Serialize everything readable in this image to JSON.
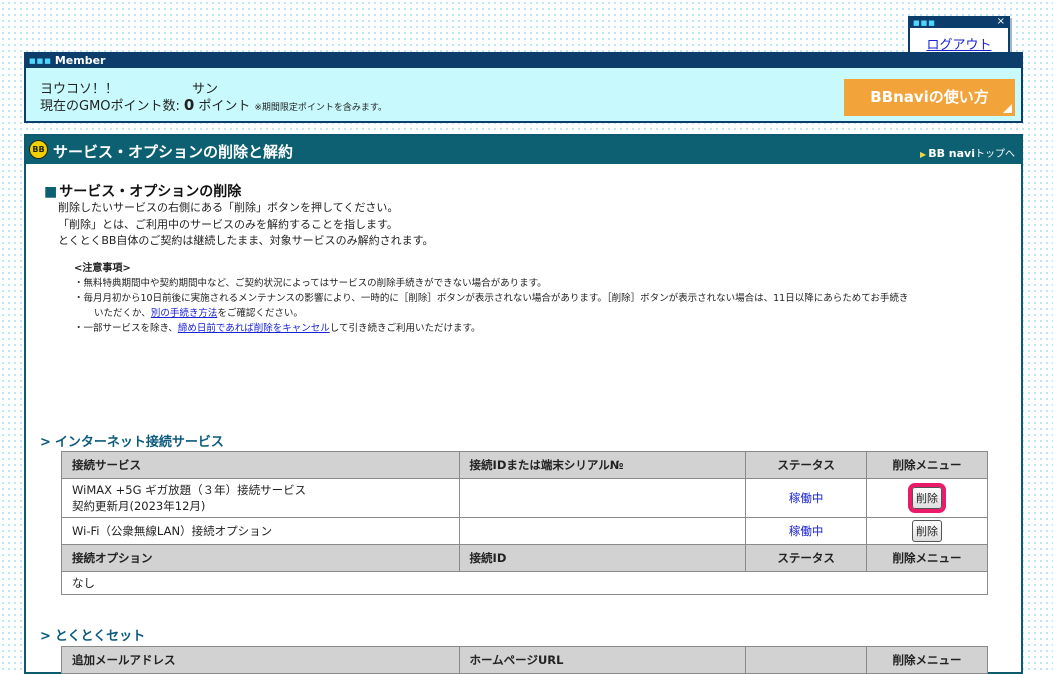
{
  "logout": {
    "label": "ログアウト"
  },
  "member": {
    "header": "Member",
    "greeting": "ヨウコソ！！",
    "honorific": "サン",
    "points_label": "現在のGMOポイント数:",
    "points_value": "0",
    "points_unit": "ポイント",
    "points_note": "※期間限定ポイントを含みます。",
    "howto_button": "BBnaviの使い方"
  },
  "main": {
    "title": "サービス・オプションの削除と解約",
    "top_link_prefix": "BB navi",
    "top_link_suffix": "トップへ",
    "section_title": "サービス・オプションの削除",
    "intro": [
      "削除したいサービスの右側にある「削除」ボタンを押してください。",
      "「削除」とは、ご利用中のサービスのみを解約することを指します。",
      "とくとくBB自体のご契約は継続したまま、対象サービスのみ解約されます。"
    ],
    "notes": {
      "heading": "<注意事項>",
      "n1": "・無料特典期間中や契約期間中など、ご契約状況によってはサービスの削除手続きができない場合があります。",
      "n2a": "・毎月月初から10日前後に実施されるメンテナンスの影響により、一時的に［削除］ボタンが表示されない場合があります。［削除］ボタンが表示されない場合は、11日以降にあらためてお手続き",
      "n2b_pre": "いただくか、",
      "n2b_link": "別の手続き方法",
      "n2b_post": "をご確認ください。",
      "n3_pre": "・一部サービスを除き、",
      "n3_link": "締め日前であれば削除をキャンセル",
      "n3_post": "して引き続きご利用いただけます。"
    }
  },
  "internet": {
    "title": "インターネット接続サービス",
    "headers": [
      "接続サービス",
      "接続IDまたは端末シリアル№",
      "ステータス",
      "削除メニュー"
    ],
    "rows": [
      {
        "service_line1": "WiMAX +5G ギガ放題（３年）接続サービス",
        "service_line2": "契約更新月(2023年12月)",
        "id": "",
        "status": "稼働中",
        "action": "削除"
      },
      {
        "service_line1": "Wi-Fi（公衆無線LAN）接続オプション",
        "id": "",
        "status": "稼働中",
        "action": "削除"
      }
    ],
    "option_headers": [
      "接続オプション",
      "接続ID",
      "ステータス",
      "削除メニュー"
    ],
    "option_empty": "なし"
  },
  "tokutoku": {
    "title": "とくとくセット",
    "headers": [
      "追加メールアドレス",
      "ホームページURL",
      "",
      "削除メニュー"
    ]
  },
  "colors": {
    "navy": "#0c3d6b",
    "teal": "#0d6072",
    "member_bg": "#c8fafd",
    "orange": "#f2a33a",
    "highlight": "#ec1b6a",
    "link": "#1a22d6"
  }
}
